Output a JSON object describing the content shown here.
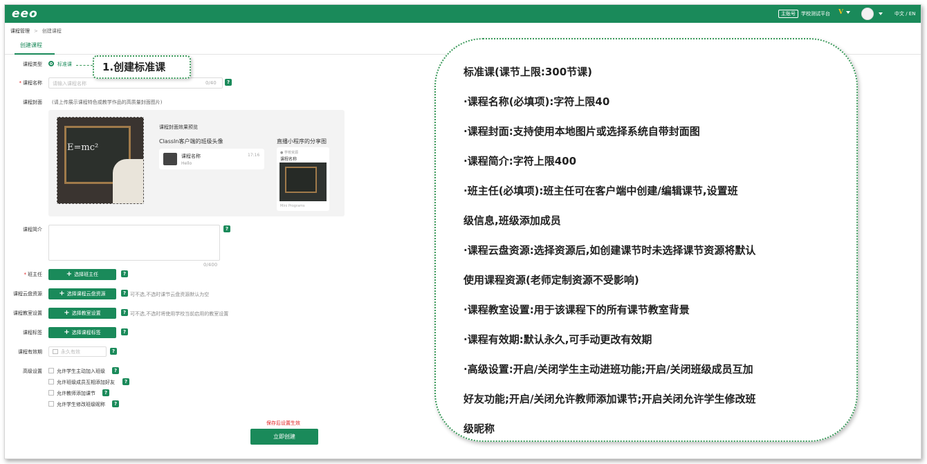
{
  "header": {
    "logo": "eeo",
    "account_badge": "主账号",
    "school": "学校测试平台",
    "vip": "V",
    "lang": "中文 / EN"
  },
  "breadcrumb": {
    "parent": "课程管理",
    "separator": ">",
    "current": "创建课程"
  },
  "tab": "创建课程",
  "form": {
    "type_label": "课程类型",
    "type_value": "标准课",
    "name_label": "课程名称",
    "name_placeholder": "请输入课程名称",
    "name_counter": "0/40",
    "cover_label": "课程封面",
    "cover_hint": "(请上传展示课程特色或教学作品的高质量封面图片)",
    "intro_label": "课程简介",
    "intro_counter": "0/400",
    "teacher_label": "班主任",
    "teacher_button": "选择班主任",
    "cloud_label": "课程云盘资源",
    "cloud_button": "选择课程云盘资源",
    "cloud_hint": "可不选,不选时课节云盘资源默认为空",
    "classroom_label": "课程教室设置",
    "classroom_button": "选择教室设置",
    "classroom_hint": "可不选,不选时将使用学校当前启用的教室设置",
    "tags_label": "课程标签",
    "tags_button": "选择课程标签",
    "validity_label": "课程有效期",
    "validity_placeholder": "永久有效",
    "advanced_label": "高级设置",
    "advanced_options": [
      "允许学生主动加入班级",
      "允许班级成员互相添加好友",
      "允许教师添加课节",
      "允许学生修改班级昵称"
    ],
    "help": "?",
    "save_warning": "保存后设置生效",
    "create_button": "立即创建"
  },
  "preview": {
    "title": "课程封面效果预览",
    "sub_client": "ClassIn客户端的班级头像",
    "sub_share": "直播小程序的分享图",
    "card_name": "课程名称",
    "card_time": "17:16",
    "card_msg": "Hello",
    "share_top": "● 学校资源",
    "share_name": "课程名称",
    "share_foot": "Mini Programs",
    "board_text": "E=mc²"
  },
  "callout1": "1.创建标准课",
  "callout2": [
    "标准课(课节上限:300节课)",
    "·课程名称(必填项):字符上限40",
    "·课程封面:支持使用本地图片或选择系统自带封面图",
    "·课程简介:字符上限400",
    "·班主任(必填项):班主任可在客户端中创建/编辑课节,设置班",
    "级信息,班级添加成员",
    "·课程云盘资源:选择资源后,如创建课节时未选择课节资源将默认",
    "使用课程资源(老师定制资源不受影响)",
    "·课程教室设置:用于该课程下的所有课节教室背景",
    "·课程有效期:默认永久,可手动更改有效期",
    "·高级设置:开启/关闭学生主动进班功能;开启/关闭班级成员互加",
    "好友功能;开启/关闭允许教师添加课节;开启关闭允许学生修改班",
    "级昵称"
  ],
  "colors": {
    "brand": "#1a8a5a",
    "warn": "#e02020",
    "callout_border": "#3a9a5a"
  }
}
